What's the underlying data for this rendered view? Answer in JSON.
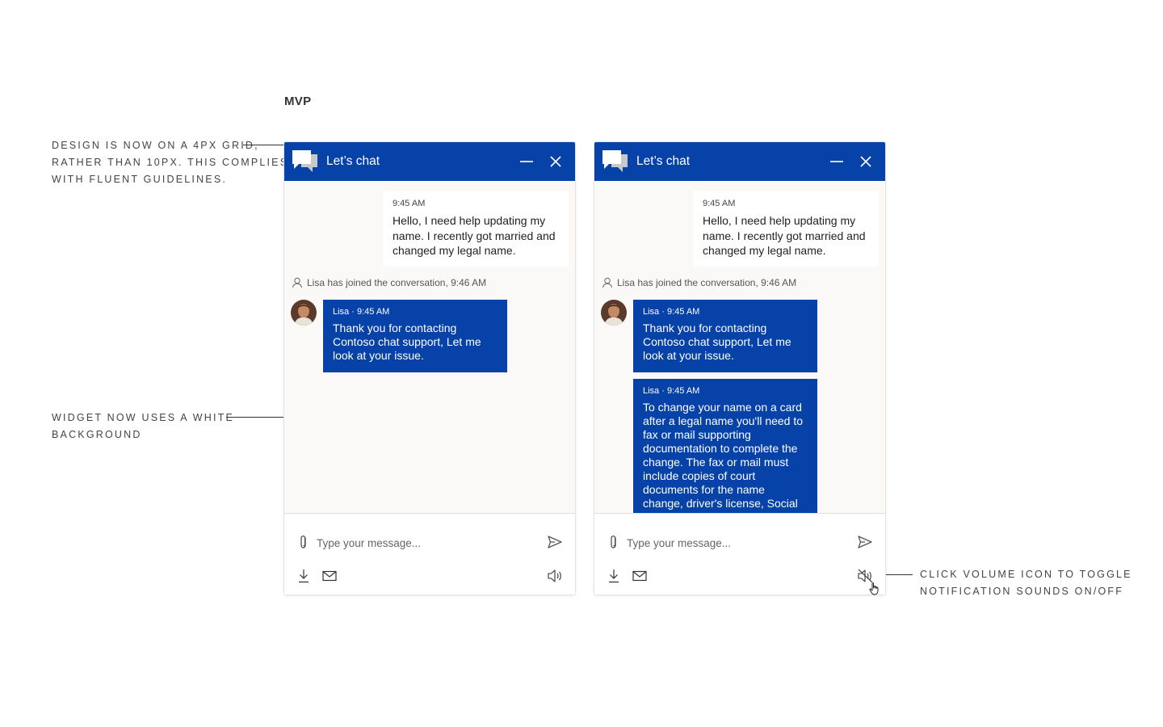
{
  "section_title": "MVP",
  "annotations": {
    "grid": [
      "Design is now on a 4px grid,",
      "rather than 10px. This complies",
      "with Fluent guidelines."
    ],
    "background": [
      "Widget now uses a white",
      "background"
    ],
    "volume": [
      "Click volume icon to toggle",
      "notification sounds on/off"
    ]
  },
  "widget": {
    "title": "Let’s chat",
    "user_message": {
      "time": "9:45 AM",
      "text": "Hello, I need help updating my name.  I recently got married and changed my legal name."
    },
    "join_notice": "Lisa has joined the conversation, 9:46 AM",
    "agent_messages": [
      {
        "meta": "Lisa · 9:45 AM",
        "text": "Thank you for contacting Contoso chat support, Let me look at your issue."
      },
      {
        "meta": "Lisa · 9:45 AM",
        "text": "To change your name on a card after a legal name you'll need to fax or mail supporting documentation to complete the change. The fax or mail must include copies of court documents for the name change, driver's license, Social"
      }
    ],
    "input_placeholder": "Type your message..."
  },
  "colors": {
    "header": "#0642a8",
    "agent_bubble": "#0642a8",
    "panel_bg": "#faf9f8"
  },
  "icons": {
    "header_icon": "chat-bubbles-icon",
    "minimize": "minimize-icon",
    "close": "close-icon",
    "attach": "paperclip-icon",
    "send": "send-icon",
    "download": "download-icon",
    "email": "mail-icon",
    "sound_on": "volume-icon",
    "sound_off": "volume-mute-icon"
  }
}
